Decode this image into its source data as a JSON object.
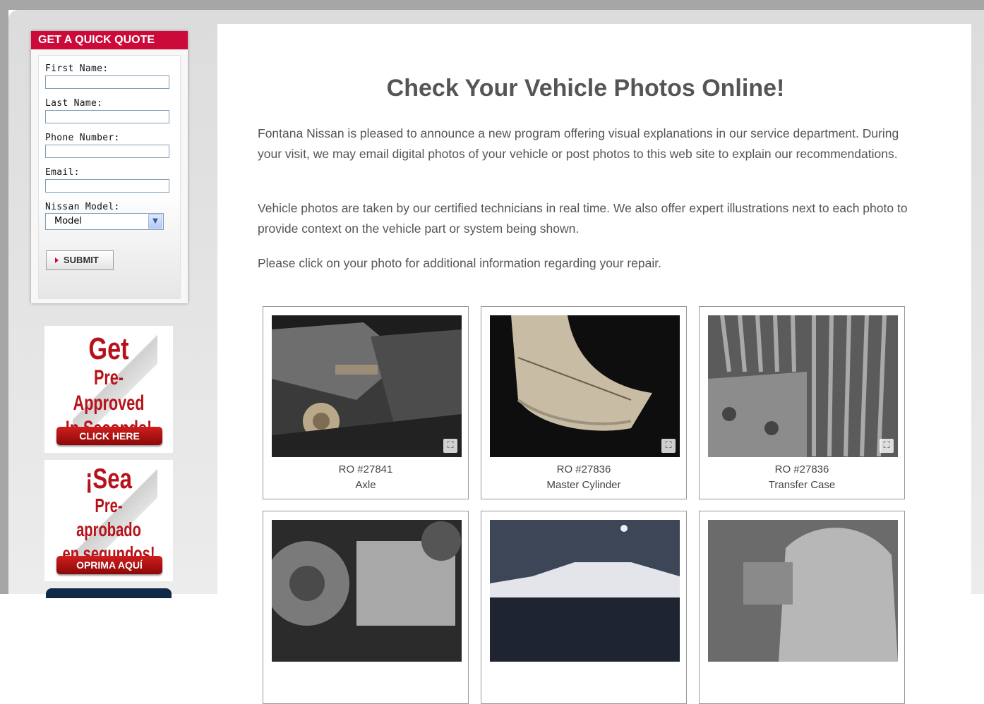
{
  "quote": {
    "header": "GET A QUICK QUOTE",
    "first_name_label": "First Name:",
    "last_name_label": "Last Name:",
    "phone_label": "Phone Number:",
    "email_label": "Email:",
    "model_label": "Nissan Model:",
    "model_selected": "Model",
    "submit_label": "SUBMIT"
  },
  "ads": {
    "english": {
      "line1": "Get",
      "line2": "Pre-Approved",
      "line3": "In Seconds!",
      "button": "CLICK HERE"
    },
    "spanish": {
      "line1": "¡Sea",
      "line2": "Pre-aprobado",
      "line3": "en segundos!",
      "button": "OPRIMA AQUÍ"
    }
  },
  "main": {
    "title": "Check Your Vehicle Photos Online!",
    "paragraphs": [
      "Fontana Nissan is pleased to announce a new program offering visual explanations in our service department. During your visit, we may email digital photos of your vehicle or post photos to this web site to explain our recommendations.",
      "Vehicle photos are taken by our certified technicians in real time. We also offer expert illustrations next to each photo to provide context on the vehicle part or system being shown.",
      "Please click on your photo for additional information regarding your repair."
    ],
    "photos": [
      {
        "ro": "RO #27841",
        "part": "Axle"
      },
      {
        "ro": "RO #27836",
        "part": "Master Cylinder"
      },
      {
        "ro": "RO #27836",
        "part": "Transfer Case"
      }
    ]
  }
}
